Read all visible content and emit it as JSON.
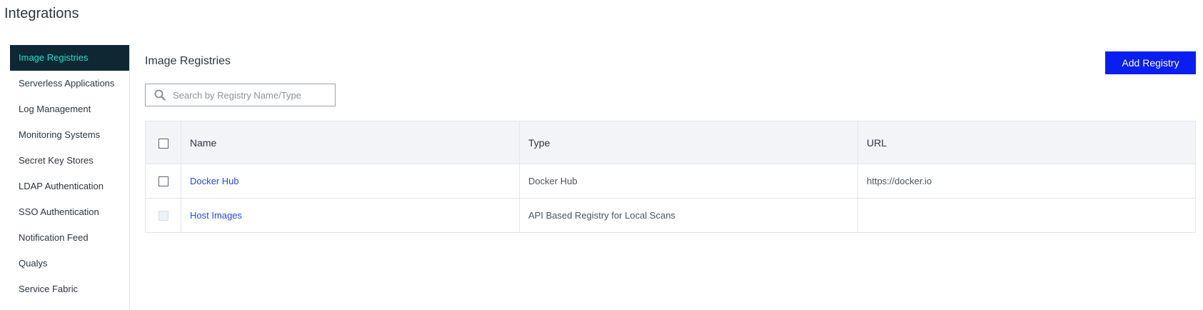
{
  "page": {
    "title": "Integrations"
  },
  "sidebar": {
    "items": [
      {
        "label": "Image Registries",
        "active": true
      },
      {
        "label": "Serverless Applications"
      },
      {
        "label": "Log Management"
      },
      {
        "label": "Monitoring Systems"
      },
      {
        "label": "Secret Key Stores"
      },
      {
        "label": "LDAP Authentication"
      },
      {
        "label": "SSO Authentication"
      },
      {
        "label": "Notification Feed"
      },
      {
        "label": "Qualys"
      },
      {
        "label": "Service Fabric"
      }
    ]
  },
  "main": {
    "title": "Image Registries",
    "add_button_label": "Add Registry",
    "search": {
      "placeholder": "Search by Registry Name/Type",
      "value": ""
    },
    "table": {
      "columns": [
        "Name",
        "Type",
        "URL"
      ],
      "rows": [
        {
          "name": "Docker Hub",
          "type": "Docker Hub",
          "url": "https://docker.io",
          "checkbox_disabled": false
        },
        {
          "name": "Host Images",
          "type": "API Based Registry for Local Scans",
          "url": "",
          "checkbox_disabled": true
        }
      ]
    }
  },
  "colors": {
    "accent": "#0a1ef2",
    "sidebar_active_bg": "#0f2733",
    "sidebar_active_text": "#18e0c8",
    "link": "#2548e6"
  }
}
